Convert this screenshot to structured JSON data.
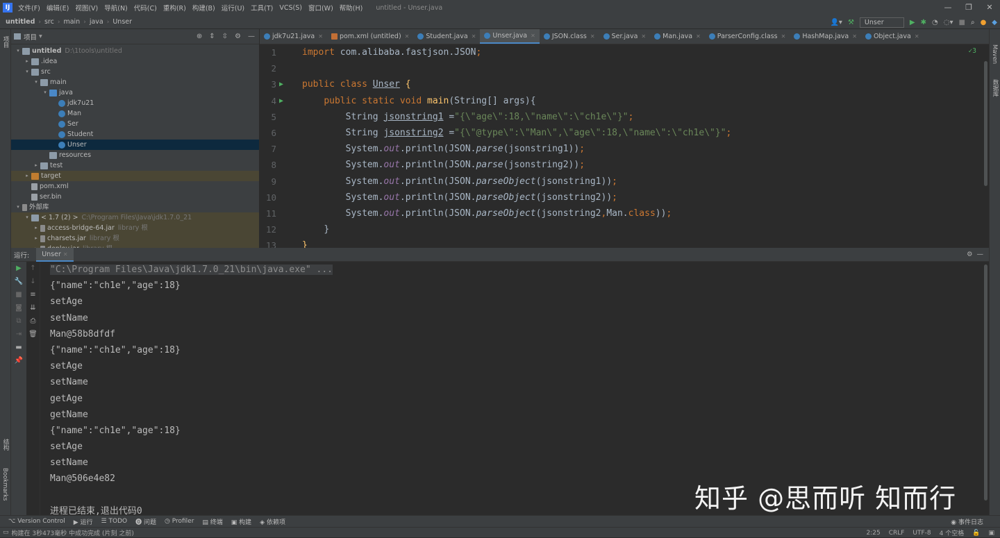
{
  "menubar": {
    "items": [
      "文件(F)",
      "编辑(E)",
      "视图(V)",
      "导航(N)",
      "代码(C)",
      "重构(R)",
      "构建(B)",
      "运行(U)",
      "工具(T)",
      "VCS(S)",
      "窗口(W)",
      "帮助(H)"
    ],
    "window_title": "untitled - Unser.java"
  },
  "navbar": {
    "crumbs": [
      "untitled",
      "src",
      "main",
      "java",
      "Unser"
    ],
    "run_config": "Unser"
  },
  "project": {
    "header": "项目",
    "tree": [
      {
        "label": "untitled",
        "extra": "D:\\1tools\\untitled",
        "depth": 0,
        "icon": "folder",
        "arrow": "▾"
      },
      {
        "label": ".idea",
        "depth": 1,
        "icon": "folder",
        "arrow": "▸"
      },
      {
        "label": "src",
        "depth": 1,
        "icon": "folder",
        "arrow": "▾"
      },
      {
        "label": "main",
        "depth": 2,
        "icon": "folder",
        "arrow": "▾"
      },
      {
        "label": "java",
        "depth": 3,
        "icon": "folder-blue",
        "arrow": "▾"
      },
      {
        "label": "jdk7u21",
        "depth": 4,
        "icon": "class",
        "arrow": ""
      },
      {
        "label": "Man",
        "depth": 4,
        "icon": "class",
        "arrow": ""
      },
      {
        "label": "Ser",
        "depth": 4,
        "icon": "class",
        "arrow": ""
      },
      {
        "label": "Student",
        "depth": 4,
        "icon": "class",
        "arrow": ""
      },
      {
        "label": "Unser",
        "depth": 4,
        "icon": "class",
        "arrow": "",
        "selected": true
      },
      {
        "label": "resources",
        "depth": 3,
        "icon": "folder",
        "arrow": ""
      },
      {
        "label": "test",
        "depth": 2,
        "icon": "folder",
        "arrow": "▸"
      },
      {
        "label": "target",
        "depth": 1,
        "icon": "folder-orange",
        "arrow": "▸",
        "highlight": true
      },
      {
        "label": "pom.xml",
        "depth": 1,
        "icon": "file",
        "arrow": ""
      },
      {
        "label": "ser.bin",
        "depth": 1,
        "icon": "file",
        "arrow": ""
      },
      {
        "label": "外部库",
        "depth": 0,
        "icon": "jar",
        "arrow": "▾"
      },
      {
        "label": "< 1.7 (2) >",
        "extra": "C:\\Program Files\\Java\\jdk1.7.0_21",
        "depth": 1,
        "icon": "folder",
        "arrow": "▾",
        "highlight": true
      },
      {
        "label": "access-bridge-64.jar",
        "extra": "library 根",
        "depth": 2,
        "icon": "jar",
        "arrow": "▸",
        "highlight": true
      },
      {
        "label": "charsets.jar",
        "extra": "library 根",
        "depth": 2,
        "icon": "jar",
        "arrow": "▸",
        "highlight": true
      },
      {
        "label": "deploy.jar",
        "extra": "library 根",
        "depth": 2,
        "icon": "jar",
        "arrow": "▸",
        "highlight": true
      }
    ]
  },
  "tabs": [
    {
      "label": "jdk7u21.java",
      "icon": "c"
    },
    {
      "label": "pom.xml (untitled)",
      "icon": "m"
    },
    {
      "label": "Student.java",
      "icon": "c"
    },
    {
      "label": "Unser.java",
      "icon": "c",
      "active": true
    },
    {
      "label": "JSON.class",
      "icon": "c"
    },
    {
      "label": "Ser.java",
      "icon": "c"
    },
    {
      "label": "Man.java",
      "icon": "c"
    },
    {
      "label": "ParserConfig.class",
      "icon": "c"
    },
    {
      "label": "HashMap.java",
      "icon": "c"
    },
    {
      "label": "Object.java",
      "icon": "c"
    }
  ],
  "inspections": "✓3",
  "code_lines": [
    {
      "n": "1",
      "run": false,
      "html": "<span class=\"kw\">import</span> <span class=\"pl\">com.alibaba.fastjson.JSON</span><span class=\"kw\">;</span>"
    },
    {
      "n": "2",
      "run": false,
      "html": ""
    },
    {
      "n": "3",
      "run": true,
      "html": "<span class=\"kw\">public class</span> <span class=\"pl ul\">Unser</span> <span class=\"fn\">{</span>"
    },
    {
      "n": "4",
      "run": true,
      "html": "    <span class=\"kw\">public static void</span> <span class=\"fn\">main</span><span class=\"pl\">(String[] args){</span>"
    },
    {
      "n": "5",
      "run": false,
      "html": "        <span class=\"pl\">String </span><span class=\"pl ul\">jsonstring1</span><span class=\"pl\"> =</span><span class=\"str\">\"{\\\"age\\\":18,\\\"name\\\":\\\"ch1e\\\"}\"</span><span class=\"kw\">;</span>"
    },
    {
      "n": "6",
      "run": false,
      "html": "        <span class=\"pl\">String </span><span class=\"pl ul\">jsonstring2</span><span class=\"pl\"> =</span><span class=\"str\">\"{\\\"@type\\\":\\\"Man\\\",\\\"age\\\":18,\\\"name\\\":\\\"ch1e\\\"}\"</span><span class=\"kw\">;</span>"
    },
    {
      "n": "7",
      "run": false,
      "html": "        <span class=\"pl\">System.</span><span class=\"it\">out</span><span class=\"pl\">.println(JSON.</span><span class=\"mi2\">parse</span><span class=\"pl\">(jsonstring1))</span><span class=\"kw\">;</span>"
    },
    {
      "n": "8",
      "run": false,
      "html": "        <span class=\"pl\">System.</span><span class=\"it\">out</span><span class=\"pl\">.println(JSON.</span><span class=\"mi2\">parse</span><span class=\"pl\">(jsonstring2))</span><span class=\"kw\">;</span>"
    },
    {
      "n": "9",
      "run": false,
      "html": "        <span class=\"pl\">System.</span><span class=\"it\">out</span><span class=\"pl\">.println(JSON.</span><span class=\"mi2\">parseObject</span><span class=\"pl\">(jsonstring1))</span><span class=\"kw\">;</span>"
    },
    {
      "n": "10",
      "run": false,
      "html": "        <span class=\"pl\">System.</span><span class=\"it\">out</span><span class=\"pl\">.println(JSON.</span><span class=\"mi2\">parseObject</span><span class=\"pl\">(jsonstring2))</span><span class=\"kw\">;</span>"
    },
    {
      "n": "11",
      "run": false,
      "html": "        <span class=\"pl\">System.</span><span class=\"it\">out</span><span class=\"pl\">.println(JSON.</span><span class=\"mi2\">parseObject</span><span class=\"pl\">(jsonstring2</span><span class=\"kw\">,</span><span class=\"pl\">Man.</span><span class=\"kw\">class</span><span class=\"pl\">))</span><span class=\"kw\">;</span>"
    },
    {
      "n": "12",
      "run": false,
      "html": "    <span class=\"pl\">}</span>"
    },
    {
      "n": "13",
      "run": false,
      "html": "<span class=\"fn\">}</span>"
    }
  ],
  "run": {
    "label": "运行:",
    "tab": "Unser",
    "output": [
      "\"C:\\Program Files\\Java\\jdk1.7.0_21\\bin\\java.exe\" ...",
      "{\"name\":\"ch1e\",\"age\":18}",
      "setAge",
      "setName",
      "Man@58b8dfdf",
      "{\"name\":\"ch1e\",\"age\":18}",
      "setAge",
      "setName",
      "getAge",
      "getName",
      "{\"name\":\"ch1e\",\"age\":18}",
      "setAge",
      "setName",
      "Man@506e4e82",
      "",
      "进程已结束,退出代码0"
    ]
  },
  "watermark": "知乎 @思而听 知而行",
  "bottom_tabs": [
    "Version Control",
    "运行",
    "TODO",
    "问题",
    "Profiler",
    "终端",
    "构建",
    "依赖项"
  ],
  "event_log": "事件日志",
  "status": {
    "message": "构建在 3秒473毫秒 中成功完成 (片刻 之前)",
    "position": "2:25",
    "line_sep": "CRLF",
    "encoding": "UTF-8",
    "indent": "4 个空格"
  },
  "side_labels": {
    "left_top": "项目",
    "left_mid": "结构",
    "left_bottom": "Bookmarks",
    "right_top": "Maven",
    "right_mid": "数据库"
  }
}
